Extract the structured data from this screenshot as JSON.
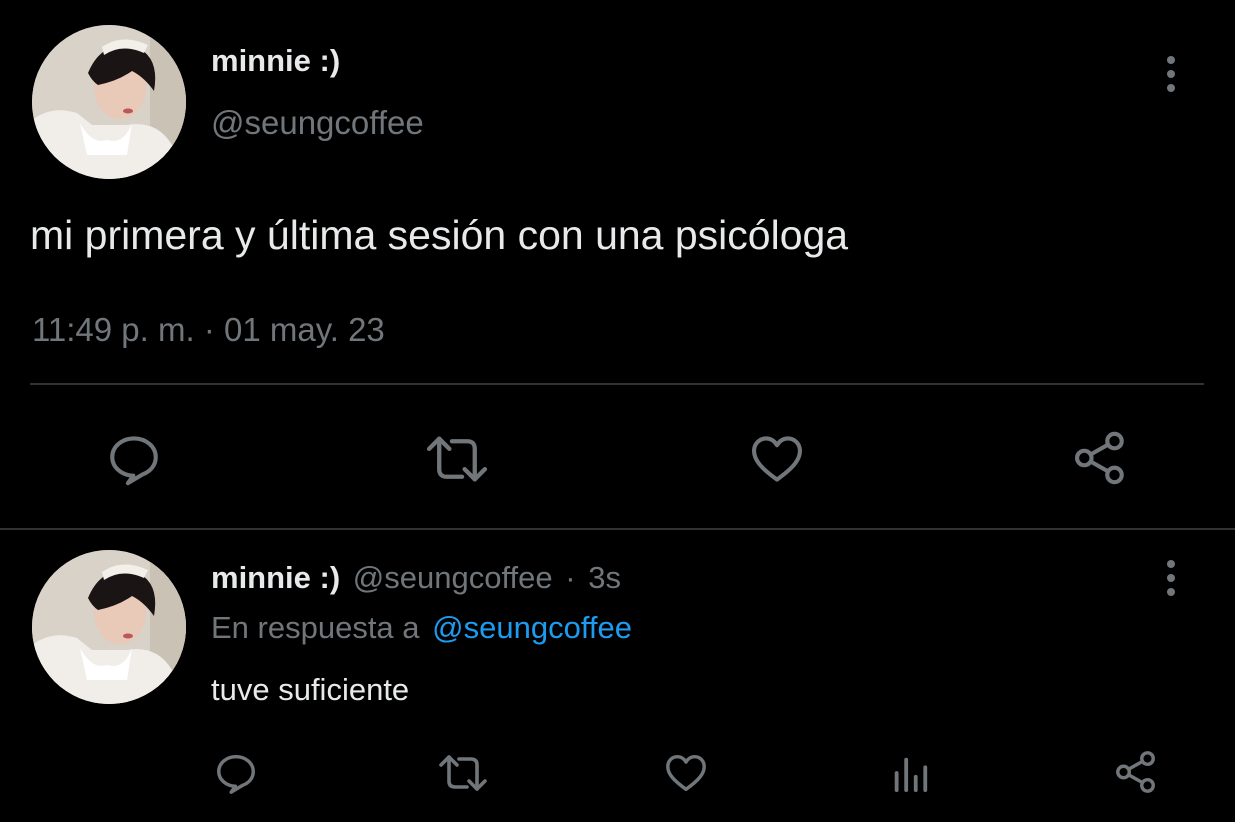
{
  "main_tweet": {
    "display_name": "minnie :)",
    "handle": "@seungcoffee",
    "text": "mi primera y última sesión con una psicóloga",
    "timestamp": "11:49 p. m. · 01 may. 23",
    "actions": [
      "reply-icon",
      "retweet-icon",
      "like-icon",
      "share-icon"
    ]
  },
  "reply_tweet": {
    "display_name": "minnie :)",
    "handle": "@seungcoffee",
    "separator": "·",
    "time": "3s",
    "reply_prefix": "En respuesta a",
    "reply_to": "@seungcoffee",
    "text": "tuve suficiente",
    "actions": [
      "reply-icon",
      "retweet-icon",
      "like-icon",
      "analytics-icon",
      "share-icon"
    ]
  },
  "colors": {
    "background": "#000000",
    "text_primary": "#e7e9ea",
    "text_secondary": "#71767b",
    "link": "#1d9bf0",
    "divider": "#2f3336",
    "icon": "#71767b"
  }
}
